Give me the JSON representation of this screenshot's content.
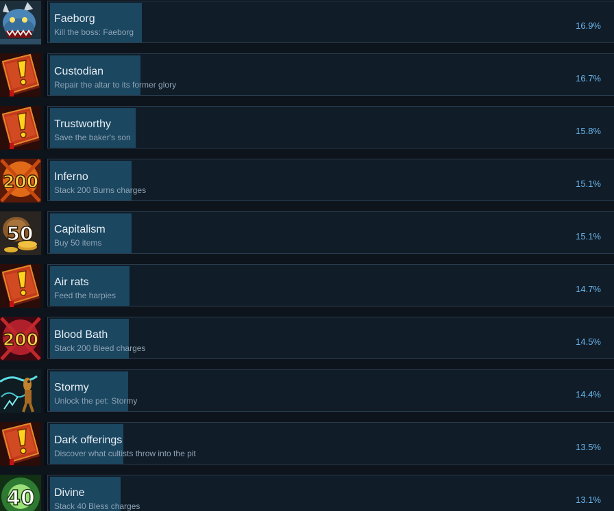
{
  "achievements": [
    {
      "icon": "dragon-boss-icon",
      "name": "Faeborg",
      "description": "Kill the boss: Faeborg",
      "percent_label": "16.9%",
      "percent": 16.9
    },
    {
      "icon": "quest-book-icon",
      "name": "Custodian",
      "description": "Repair the altar to its former glory",
      "percent_label": "16.7%",
      "percent": 16.7
    },
    {
      "icon": "quest-book-icon",
      "name": "Trustworthy",
      "description": "Save the baker's son",
      "percent_label": "15.8%",
      "percent": 15.8
    },
    {
      "icon": "burn-charges-icon",
      "icon_number": "200",
      "name": "Inferno",
      "description": "Stack 200 Burns charges",
      "percent_label": "15.1%",
      "percent": 15.1
    },
    {
      "icon": "gold-coins-icon",
      "icon_number": "50",
      "name": "Capitalism",
      "description": "Buy 50 items",
      "percent_label": "15.1%",
      "percent": 15.1
    },
    {
      "icon": "quest-book-icon",
      "name": "Air rats",
      "description": "Feed the harpies",
      "percent_label": "14.7%",
      "percent": 14.7
    },
    {
      "icon": "bleed-charges-icon",
      "icon_number": "200",
      "name": "Blood Bath",
      "description": "Stack 200 Bleed charges",
      "percent_label": "14.5%",
      "percent": 14.5
    },
    {
      "icon": "storm-pet-icon",
      "name": "Stormy",
      "description": "Unlock the pet: Stormy",
      "percent_label": "14.4%",
      "percent": 14.4
    },
    {
      "icon": "quest-book-icon",
      "name": "Dark offerings",
      "description": "Discover what cultists throw into the pit",
      "percent_label": "13.5%",
      "percent": 13.5
    },
    {
      "icon": "bless-charges-icon",
      "icon_number": "40",
      "name": "Divine",
      "description": "Stack 40 Bless charges",
      "percent_label": "13.1%",
      "percent": 13.1
    }
  ],
  "colors": {
    "background": "#0e141c",
    "panel": "#101c27",
    "progress_fill": "#1b4761",
    "percent_text": "#6ab6ef"
  }
}
